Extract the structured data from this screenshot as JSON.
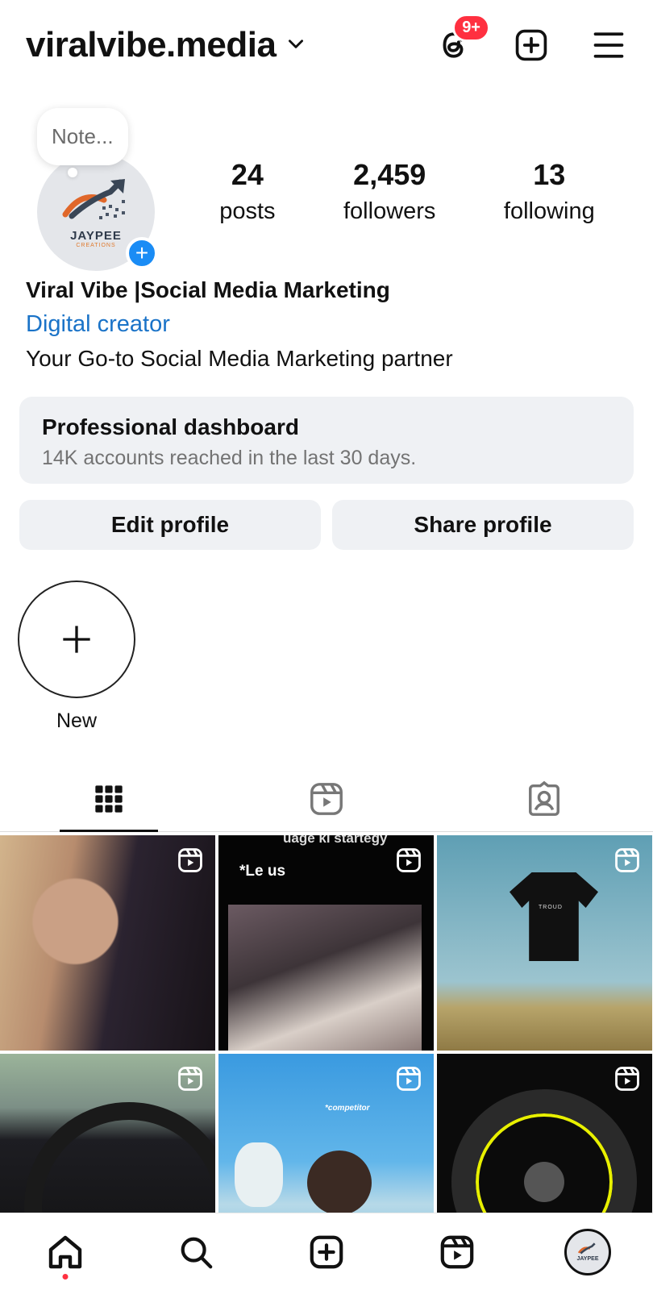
{
  "header": {
    "username": "viralvibe.media",
    "threads_badge": "9+"
  },
  "note": {
    "placeholder": "Note..."
  },
  "avatar": {
    "brand": "JAYPEE",
    "sub": "CREATIONS"
  },
  "stats": [
    {
      "value": "24",
      "label": "posts"
    },
    {
      "value": "2,459",
      "label": "followers"
    },
    {
      "value": "13",
      "label": "following"
    }
  ],
  "bio": {
    "name": "Viral Vibe |Social Media Marketing",
    "category": "Digital creator",
    "text": "Your Go-to Social Media Marketing partner"
  },
  "dashboard": {
    "title": "Professional dashboard",
    "subtitle": "14K accounts reached in the last 30 days."
  },
  "buttons": {
    "edit": "Edit profile",
    "share": "Share profile"
  },
  "highlight": {
    "label": "New"
  },
  "tabs": [
    "grid-icon",
    "reels-icon",
    "tagged-icon"
  ],
  "grid": {
    "tile2_caption": "*Le us",
    "tile2_top": "uage ki startegy",
    "tile3_shirt": "TROUD",
    "tile5_caption": "*competitor"
  },
  "colors": {
    "accent": "#1a8cf5",
    "link": "#1a73c8",
    "badge": "#ff3040"
  }
}
